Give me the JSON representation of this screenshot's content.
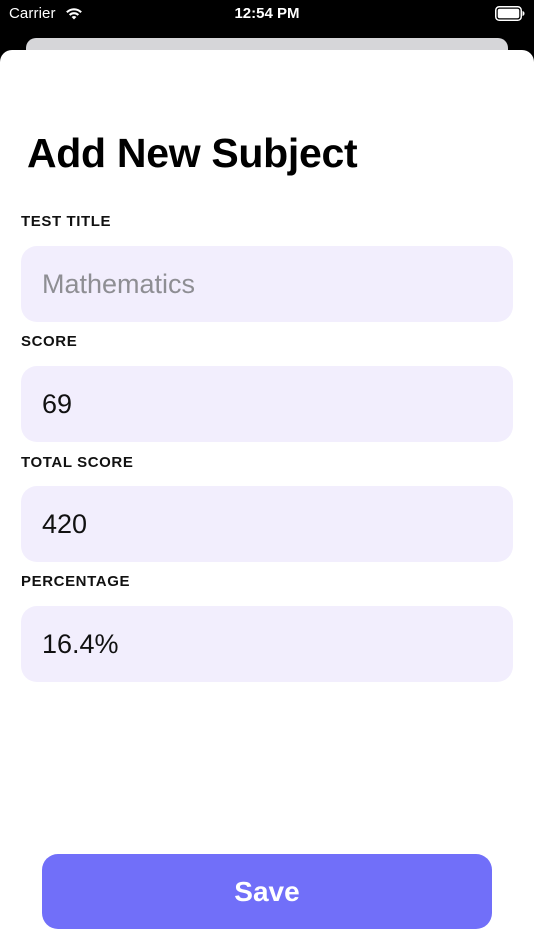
{
  "status_bar": {
    "carrier": "Carrier",
    "time": "12:54 PM",
    "wifi_icon": "wifi-icon",
    "battery_icon": "battery-icon"
  },
  "sheet": {
    "title": "Add New Subject"
  },
  "form": {
    "test_title": {
      "label": "TEST TITLE",
      "value": "",
      "placeholder": "Mathematics"
    },
    "score": {
      "label": "SCORE",
      "value": "69"
    },
    "total_score": {
      "label": "TOTAL SCORE",
      "value": "420"
    },
    "percentage": {
      "label": "PERCENTAGE",
      "value": "16.4%"
    }
  },
  "actions": {
    "save_label": "Save"
  },
  "colors": {
    "field_background": "#f2eefd",
    "accent": "#716ff9",
    "placeholder": "#8e8e93"
  }
}
